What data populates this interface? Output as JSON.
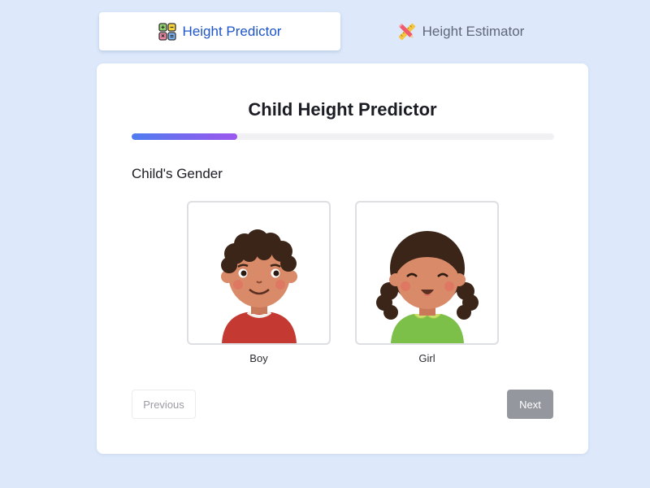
{
  "tabs": [
    {
      "label": "Height Predictor",
      "icon": "calculator-grid-icon",
      "active": true
    },
    {
      "label": "Height Estimator",
      "icon": "ruler-pencil-icon",
      "active": false
    }
  ],
  "card": {
    "title": "Child Height Predictor",
    "progress": 0.25,
    "section_label": "Child's Gender",
    "options": [
      {
        "label": "Boy",
        "icon": "boy-avatar-icon"
      },
      {
        "label": "Girl",
        "icon": "girl-avatar-icon"
      }
    ],
    "buttons": {
      "previous": "Previous",
      "next": "Next"
    }
  },
  "colors": {
    "background": "#dde9fb",
    "active_tab_text": "#1e55c8",
    "progress_start": "#4f7cf0",
    "progress_end": "#9c57ee",
    "next_button": "#94979d"
  }
}
